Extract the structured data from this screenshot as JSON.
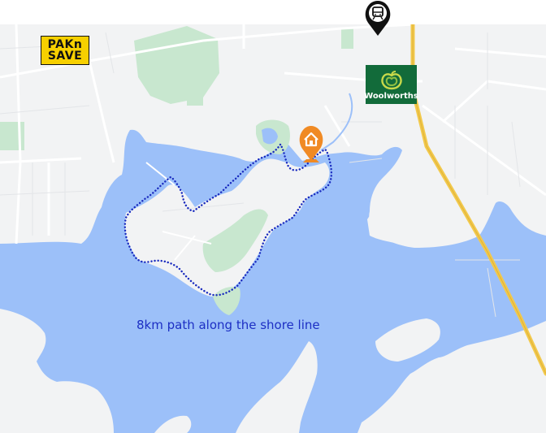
{
  "map": {
    "annotation_text": "8km path along the shore line",
    "colors": {
      "water": "#9cc0f9",
      "land": "#f2f3f4",
      "park": "#c8e7cf",
      "highway": "#f2c94c",
      "path": "#1a2bbf",
      "home_pin": "#f08a24"
    }
  },
  "markers": {
    "transit": {
      "icon": "train-station-icon"
    },
    "home": {
      "icon": "home-pin-icon"
    }
  },
  "brands": {
    "paknsave": {
      "line1": "PAKn",
      "line2": "SAVE"
    },
    "woolworths": {
      "name": "Woolworths"
    }
  }
}
